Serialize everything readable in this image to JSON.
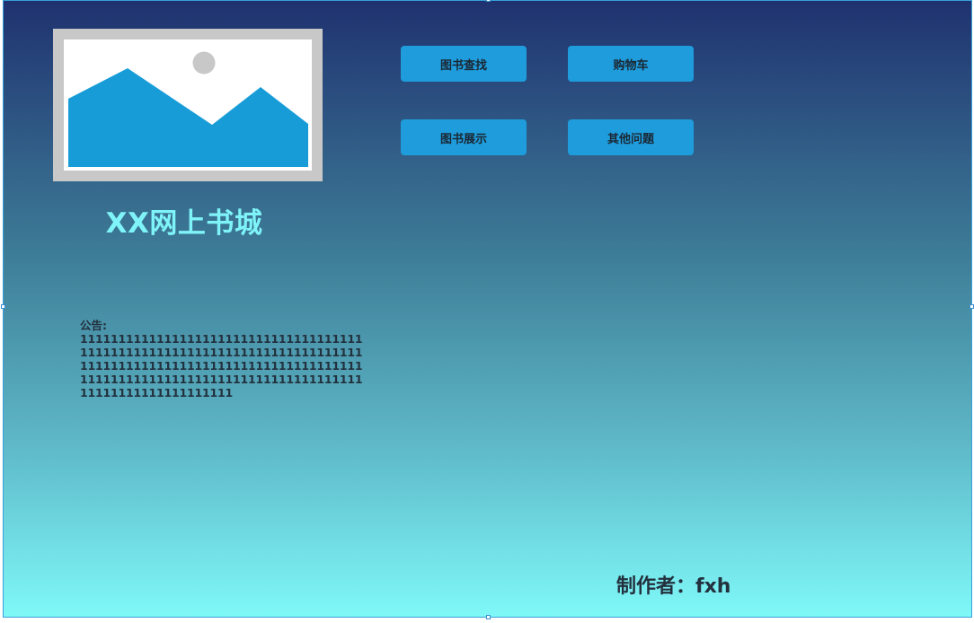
{
  "header": {
    "site_title": "XX网上书城"
  },
  "nav": {
    "buttons": [
      {
        "label": "图书查找"
      },
      {
        "label": "购物车"
      },
      {
        "label": "图书展示"
      },
      {
        "label": "其他问题"
      }
    ]
  },
  "notice": {
    "title": "公告:",
    "body": "111111111111111111111111111111111111111111111111111111111111111111111111111111111111111111111111111111111111111111111111111111111111111111111111111111111111111111111111"
  },
  "footer": {
    "author": "制作者：fxh"
  },
  "colors": {
    "gradient_top": "#1f3270",
    "gradient_bottom": "#7ff8f8",
    "button_bg": "#1e9cdc",
    "title_color": "#7ff4f8",
    "selection_border": "#3aa0d8"
  },
  "icons": {
    "image_placeholder": "image-placeholder-icon"
  }
}
